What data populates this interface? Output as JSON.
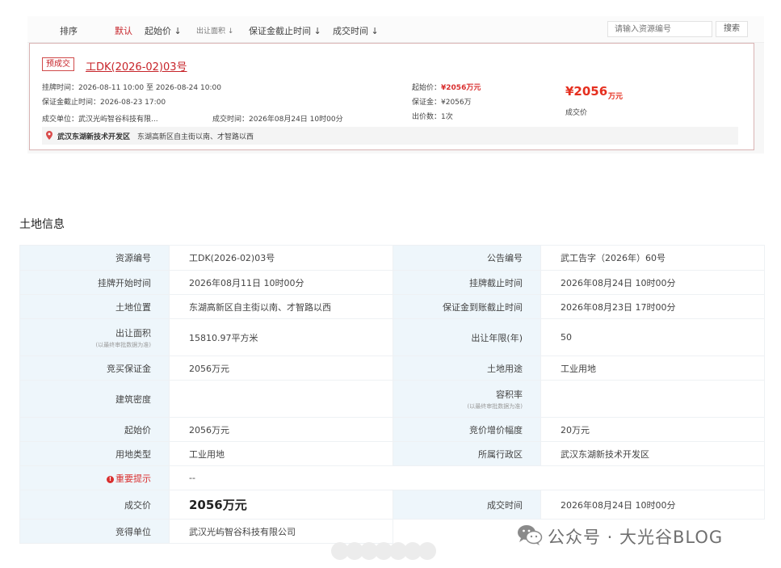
{
  "sortbar": {
    "items": [
      "排序",
      "默认",
      "起始价 ↓",
      "出让面积 ↓",
      "保证金截止时间 ↓",
      "成交时间 ↓"
    ],
    "search_placeholder": "请输入资源编号",
    "search_label": "搜索"
  },
  "listing": {
    "tag": "预成交",
    "title": "工DK(2026-02)03号",
    "listing_time": "挂牌时间：2026-08-11 10:00  至  2026-08-24 10:00",
    "deposit_deadline": "保证金截止时间：2026-08-23 17:00",
    "deal_unit": "成交单位：武汉光屿智谷科技有限...",
    "deal_time": "成交时间：2026年08月24日 10时00分",
    "start_price_label": "起始价：",
    "start_price": "¥2056万元",
    "deposit": "保证金：¥2056万",
    "bid_count": "出价数：1次",
    "final_price": "¥2056",
    "final_unit": "万元",
    "final_label": "成交价",
    "district": "武汉东湖新技术开发区",
    "address": "东湖高新区自主街以南、才智路以西"
  },
  "land_info": {
    "title": "土地信息",
    "rows": [
      {
        "l1": "资源编号",
        "v1": "工DK(2026-02)03号",
        "l2": "公告编号",
        "v2": "武工告字（2026年）60号"
      },
      {
        "l1": "挂牌开始时间",
        "v1": "2026年08月11日 10时00分",
        "l2": "挂牌截止时间",
        "v2": "2026年08月24日 10时00分"
      },
      {
        "l1": "土地位置",
        "v1": "东湖高新区自主街以南、才智路以西",
        "l2": "保证金到账截止时间",
        "v2": "2026年08月23日 17时00分"
      },
      {
        "l1": "出让面积",
        "n1": "(以最终审批数据为准)",
        "v1": "15810.97平方米",
        "l2": "出让年限(年)",
        "v2": "50"
      },
      {
        "l1": "竞买保证金",
        "v1": "2056万元",
        "l2": "土地用途",
        "v2": "工业用地"
      },
      {
        "l1": "建筑密度",
        "v1": "",
        "l2": "容积率",
        "n2": "(以最终审批数据为准)",
        "v2": ""
      },
      {
        "l1": "起始价",
        "v1": "2056万元",
        "l2": "竞价增价幅度",
        "v2": "20万元"
      },
      {
        "l1": "用地类型",
        "v1": "工业用地",
        "l2": "所属行政区",
        "v2": "武汉东湖新技术开发区"
      }
    ],
    "important_label": "重要提示",
    "important_value": "--",
    "deal_price_label": "成交价",
    "deal_price": "2056万元",
    "deal_time_label": "成交时间",
    "deal_time": "2026年08月24日 10时00分",
    "winner_label": "竞得单位",
    "winner": "武汉光屿智谷科技有限公司"
  },
  "watermark": "公众号 · 大光谷BLOG",
  "colors": {
    "accent": "#c7242a",
    "label_bg": "#eef6fb",
    "price_red": "#e52f1f"
  }
}
